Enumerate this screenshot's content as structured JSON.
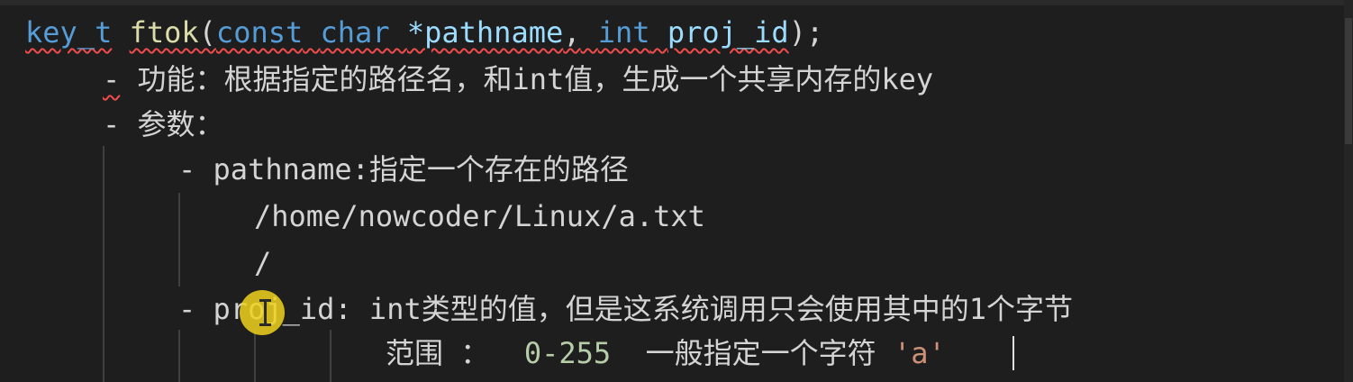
{
  "editor": {
    "line1": {
      "return_type": "key_t",
      "func_name": "ftok",
      "open_paren": "(",
      "kw_const": "const",
      "kw_char": "char",
      "ptr_param": "*pathname",
      "comma": ",",
      "kw_int": "int",
      "param2": "proj_id",
      "close": ");"
    },
    "line2": {
      "dash": "-",
      "text": " 功能：根据指定的路径名，和int值，生成一个共享内存的key"
    },
    "line3": {
      "text": "- 参数："
    },
    "line4": {
      "text": "- pathname:指定一个存在的路径"
    },
    "line5": {
      "text": "/home/nowcoder/Linux/a.txt"
    },
    "line6": {
      "text": "/"
    },
    "line7": {
      "text": "- proj_id: int类型的值，但是这系统调用只会使用其中的1个字节"
    },
    "line8": {
      "label": "范围 ：",
      "range": "0-255",
      "middle": "一般指定一个字符",
      "char_literal": "'a'"
    }
  },
  "colors": {
    "background": "#1e1e1e",
    "keyword": "#569cd6",
    "function": "#dcdcaa",
    "parameter": "#9cdcfe",
    "number": "#b5cea8",
    "string": "#ce9178",
    "text": "#d4d4d4",
    "error_squiggle": "#f14c4c"
  },
  "pointer": {
    "icon": "ibeam-cursor-icon"
  }
}
